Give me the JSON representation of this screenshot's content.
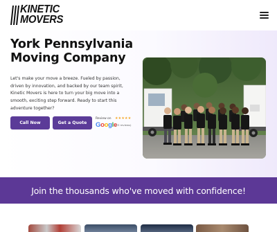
{
  "header": {
    "logo_line1": "KINETIC",
    "logo_line2": "MOVERS",
    "menu_icon": "hamburger-menu-icon"
  },
  "hero": {
    "title_line1": "York Pennsylvania",
    "title_line2": "Moving Company",
    "description": "Let's make your move a breeze. Fueled by passion, driven by innovation, and backed by our team spirit, Kinetic Movers is here to turn your big move into a smooth, exciting step forward. Ready to start this adventure together?",
    "call_button": "Call Now",
    "quote_button": "Get a Quote",
    "review": {
      "label": "Review on",
      "stars": "★★★★★",
      "brand": "Google",
      "count": "(23 reviews)"
    }
  },
  "band": {
    "text": "Join the thousands who've moved with confidence!"
  },
  "colors": {
    "brand_purple": "#5b3b98",
    "band_purple": "#5c3896",
    "star_gold": "#f5a623"
  }
}
